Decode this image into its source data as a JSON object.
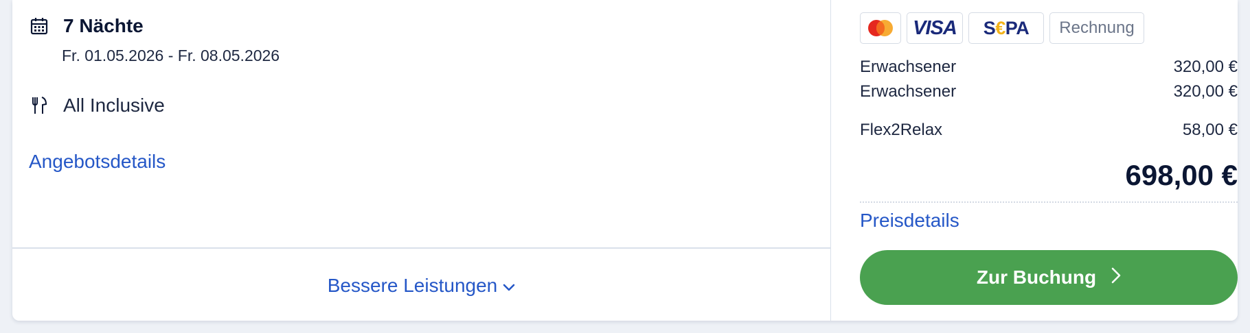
{
  "offer": {
    "nights": "7 Nächte",
    "dates": "Fr. 01.05.2026 - Fr. 08.05.2026",
    "board": "All Inclusive",
    "details_link": "Angebotsdetails",
    "better_services": "Bessere Leistungen"
  },
  "payments": {
    "methods": [
      {
        "name": "mastercard",
        "label": ""
      },
      {
        "name": "visa",
        "label": "VISA"
      },
      {
        "name": "sepa",
        "label_left": "S",
        "label_mid": "€",
        "label_right": "PA"
      },
      {
        "name": "invoice",
        "label": "Rechnung"
      }
    ]
  },
  "price": {
    "lines": [
      {
        "label": "Erwachsener",
        "amount": "320,00 €"
      },
      {
        "label": "Erwachsener",
        "amount": "320,00 €"
      },
      {
        "label": "Flex2Relax",
        "amount": "58,00 €"
      }
    ],
    "total": "698,00 €",
    "details_link": "Preisdetails",
    "book_button": "Zur Buchung"
  },
  "colors": {
    "link": "#2557c7",
    "button": "#4aa150",
    "text": "#0b1633"
  },
  "icons": [
    "calendar-icon",
    "cutlery-icon",
    "chevron-down-icon",
    "chevron-right-icon",
    "mastercard-icon"
  ]
}
